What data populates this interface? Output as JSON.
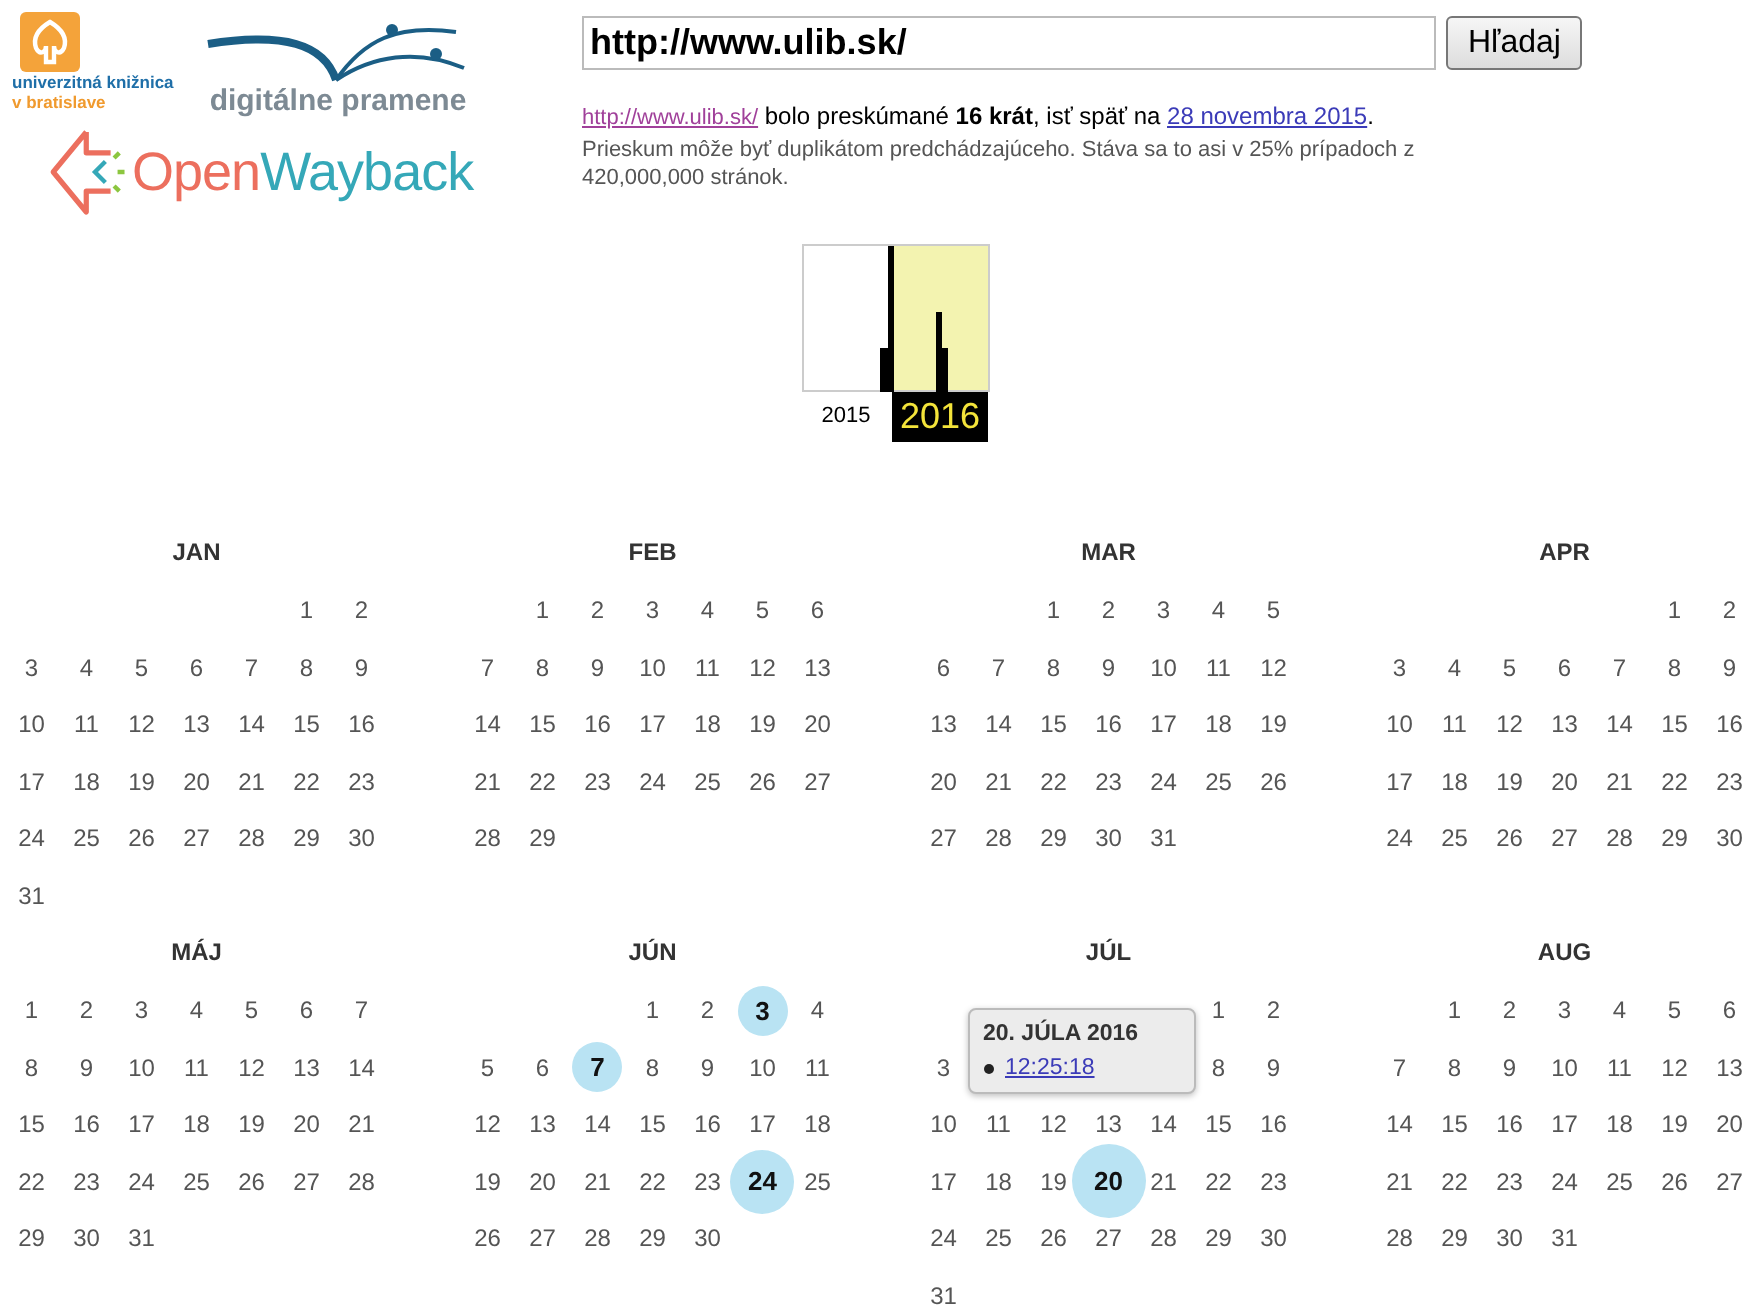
{
  "logos": {
    "library": [
      "univerzitná knižnica",
      "v bratislave"
    ],
    "digital": "digitálne pramene",
    "wayback": [
      "Open",
      "Wayback"
    ]
  },
  "search": {
    "value": "http://www.ulib.sk/",
    "button": "Hľadaj"
  },
  "summary": {
    "url": "http://www.ulib.sk/",
    "middle": " bolo preskúmané **16 krát**, isť späť na ",
    "date": "28 novembra 2015",
    "end": "."
  },
  "note": "Prieskum môže byť duplikátom predchádzajúceho. Stáva sa to asi v 25% prípadoch z 420,000,000 stránok.",
  "years": [
    {
      "label": "2015",
      "selected": false
    },
    {
      "label": "2016",
      "selected": true
    }
  ],
  "months": [
    {
      "name": "JAN",
      "weeks": [
        [
          "1",
          "2"
        ],
        [
          "3",
          "4",
          "5",
          "6",
          "7",
          "8",
          "9"
        ],
        [
          "10",
          "11",
          "12",
          "13",
          "14",
          "15",
          "16"
        ],
        [
          "17",
          "18",
          "19",
          "20",
          "21",
          "22",
          "23"
        ],
        [
          "24",
          "25",
          "26",
          "27",
          "28",
          "29",
          "30"
        ],
        [
          "31"
        ]
      ]
    },
    {
      "name": "FEB",
      "weeks": [
        [
          "1",
          "2",
          "3",
          "4",
          "5",
          "6"
        ],
        [
          "7",
          "8",
          "9",
          "10",
          "11",
          "12",
          "13"
        ],
        [
          "14",
          "15",
          "16",
          "17",
          "18",
          "19",
          "20"
        ],
        [
          "21",
          "22",
          "23",
          "24",
          "25",
          "26",
          "27"
        ],
        [
          "28",
          "29"
        ]
      ]
    },
    {
      "name": "MAR",
      "weeks": [
        [
          "1",
          "2",
          "3",
          "4",
          "5"
        ],
        [
          "6",
          "7",
          "8",
          "9",
          "10",
          "11",
          "12"
        ],
        [
          "13",
          "14",
          "15",
          "16",
          "17",
          "18",
          "19"
        ],
        [
          "20",
          "21",
          "22",
          "23",
          "24",
          "25",
          "26"
        ],
        [
          "27",
          "28",
          "29",
          "30",
          "31"
        ]
      ]
    },
    {
      "name": "APR",
      "weeks": [
        [
          "1",
          "2"
        ],
        [
          "3",
          "4",
          "5",
          "6",
          "7",
          "8",
          "9"
        ],
        [
          "10",
          "11",
          "12",
          "13",
          "14",
          "15",
          "16"
        ],
        [
          "17",
          "18",
          "19",
          "20",
          "21",
          "22",
          "23"
        ],
        [
          "24",
          "25",
          "26",
          "27",
          "28",
          "29",
          "30"
        ]
      ]
    },
    {
      "name": "MÁJ",
      "weeks": [
        [
          "1",
          "2",
          "3",
          "4",
          "5",
          "6",
          "7"
        ],
        [
          "8",
          "9",
          "10",
          "11",
          "12",
          "13",
          "14"
        ],
        [
          "15",
          "16",
          "17",
          "18",
          "19",
          "20",
          "21"
        ],
        [
          "22",
          "23",
          "24",
          "25",
          "26",
          "27",
          "28"
        ],
        [
          "29",
          "30",
          "31"
        ]
      ]
    },
    {
      "name": "JÚN",
      "weeks": [
        [
          "1",
          "2",
          {
            "kind": "small",
            "day": "3"
          },
          "4"
        ],
        [
          "5",
          "6",
          {
            "kind": "small",
            "day": "7"
          },
          "8",
          "9",
          "10",
          "11"
        ],
        [
          "12",
          "13",
          "14",
          "15",
          "16",
          "17",
          "18"
        ],
        [
          "19",
          "20",
          "21",
          "22",
          "23",
          {
            "kind": "medium",
            "day": "24"
          },
          "25"
        ],
        [
          "26",
          "27",
          "28",
          "29",
          "30"
        ]
      ]
    },
    {
      "name": "JÚL",
      "weeks": [
        [
          "1",
          "2"
        ],
        [
          "3",
          {
            "kind": "tooltip",
            "title": "20. JÚLA 2016",
            "times": [
              "12:25:18"
            ]
          },
          "8",
          "9"
        ],
        [
          "10",
          "11",
          "12",
          "13",
          "14",
          "15",
          "16"
        ],
        [
          "17",
          "18",
          "19",
          {
            "kind": "large",
            "day": "20"
          },
          "21",
          "22",
          "23"
        ],
        [
          "24",
          "25",
          "26",
          "27",
          "28",
          "29",
          "30"
        ],
        [
          "31"
        ]
      ]
    },
    {
      "name": "AUG",
      "weeks": [
        [
          "1",
          "2",
          "3",
          "4",
          "5",
          "6"
        ],
        [
          "7",
          "8",
          "9",
          "10",
          "11",
          "12",
          "13"
        ],
        [
          "14",
          "15",
          "16",
          "17",
          "18",
          "19",
          "20"
        ],
        [
          "21",
          "22",
          "23",
          "24",
          "25",
          "26",
          "27"
        ],
        [
          "28",
          "29",
          "30",
          "31"
        ]
      ]
    }
  ]
}
